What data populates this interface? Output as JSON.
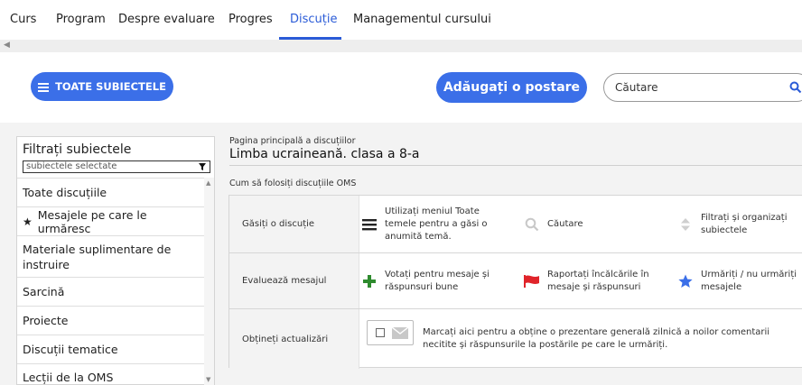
{
  "tabs": [
    {
      "label": "Curs"
    },
    {
      "label": "Program"
    },
    {
      "label": "Despre evaluare"
    },
    {
      "label": "Progres"
    },
    {
      "label": "Discuție"
    },
    {
      "label": "Managementul cursului"
    }
  ],
  "active_tab": "Discuție",
  "toolbar": {
    "all_topics_label": "TOATE SUBIECTELE",
    "add_post_label": "Adăugați o postare",
    "search_placeholder": "Căutare"
  },
  "sidebar": {
    "title": "Filtrați subiectele",
    "select_value": "subiectele selectate",
    "items": [
      {
        "label": "Toate discuțiile"
      },
      {
        "label": "Mesajele pe care le urmăresc"
      },
      {
        "label": "Materiale suplimentare de instruire"
      },
      {
        "label": "Sarcină"
      },
      {
        "label": "Proiecte"
      },
      {
        "label": "Discuții tematice"
      },
      {
        "label": "Lecții de la OMS"
      }
    ]
  },
  "breadcrumb": {
    "label": "Pagina principală a discuțiilor",
    "title": "Limba ucraineană. clasa a 8-a"
  },
  "howto_title": "Cum să folosiți discuțiile OMS",
  "guide": {
    "rows": [
      {
        "label": "Găsiți o discuție",
        "cells": [
          {
            "icon": "menu-icon",
            "text": "Utilizați meniul Toate temele pentru a găsi o anumită temă."
          },
          {
            "icon": "search-icon",
            "text": "Căutare"
          },
          {
            "icon": "sort-icon",
            "text": "Filtrați și organizați subiectele"
          }
        ]
      },
      {
        "label": "Evaluează mesajul",
        "cells": [
          {
            "icon": "plus-icon",
            "text": "Votați pentru mesaje și răspunsuri bune"
          },
          {
            "icon": "flag-icon",
            "text": "Raportați încălcările în mesaje și răspunsuri"
          },
          {
            "icon": "star-icon",
            "text": "Urmăriți / nu urmăriți mesajele"
          }
        ]
      },
      {
        "label": "Obțineți actualizări",
        "digest_text": "Marcați aici pentru a obține o prezentare generală zilnică a noilor comentarii necitite și răspunsurile la postările pe care le urmăriți."
      }
    ]
  },
  "colors": {
    "accent": "#3b6fe8",
    "plus_green": "#2e8b2e",
    "flag_red": "#e0242a",
    "star_blue": "#3b6fe8"
  }
}
